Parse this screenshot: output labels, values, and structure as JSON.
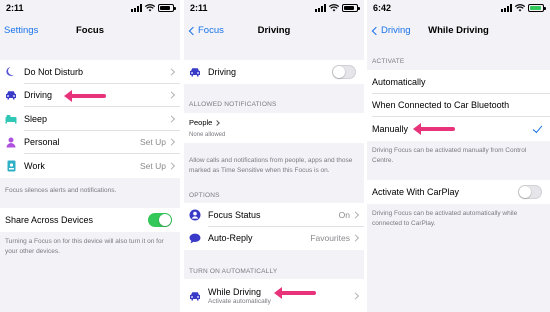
{
  "panel1": {
    "status_time": "2:11",
    "nav_back": "Settings",
    "nav_title": "Focus",
    "items": [
      {
        "label": "Do Not Disturb",
        "value": "",
        "icon": "moon-icon",
        "color": "#5856d6"
      },
      {
        "label": "Driving",
        "value": "",
        "icon": "car-icon",
        "color": "#3a3ac8"
      },
      {
        "label": "Sleep",
        "value": "",
        "icon": "bed-icon",
        "color": "#30c7b7"
      },
      {
        "label": "Personal",
        "value": "Set Up",
        "icon": "person-icon",
        "color": "#af52de"
      },
      {
        "label": "Work",
        "value": "Set Up",
        "icon": "badge-icon",
        "color": "#30b0c7"
      }
    ],
    "note1": "Focus silences alerts and notifications.",
    "share_label": "Share Across Devices",
    "share_on": true,
    "note2": "Turning a Focus on for this device will also turn it on for your other devices."
  },
  "panel2": {
    "status_time": "2:11",
    "nav_back": "Focus",
    "nav_title": "Driving",
    "driving_label": "Driving",
    "driving_on": false,
    "allowed_header": "ALLOWED NOTIFICATIONS",
    "people_label": "People",
    "people_sub": "None allowed",
    "allowed_note": "Allow calls and notifications from people, apps and those marked as Time Sensitive when this Focus is on.",
    "options_header": "OPTIONS",
    "options": [
      {
        "label": "Focus Status",
        "value": "On",
        "icon": "person-circle-icon",
        "color": "#3a3ac8"
      },
      {
        "label": "Auto-Reply",
        "value": "Favourites",
        "icon": "speech-bubble-icon",
        "color": "#3a3ac8"
      }
    ],
    "auto_header": "TURN ON AUTOMATICALLY",
    "auto_label": "While Driving",
    "auto_sub": "Activate automatically"
  },
  "panel3": {
    "status_time": "6:42",
    "nav_back": "Driving",
    "nav_title": "While Driving",
    "activate_header": "ACTIVATE",
    "options": [
      {
        "label": "Automatically",
        "selected": false
      },
      {
        "label": "When Connected to Car Bluetooth",
        "selected": false
      },
      {
        "label": "Manually",
        "selected": true
      }
    ],
    "activate_note": "Driving Focus can be activated manually from Control Centre.",
    "carplay_label": "Activate With CarPlay",
    "carplay_on": false,
    "carplay_note": "Driving Focus can be activated automatically while connected to CarPlay."
  },
  "colors": {
    "accent": "#1a73e8",
    "toggle_on": "#34c759",
    "arrow": "#e8337a"
  }
}
